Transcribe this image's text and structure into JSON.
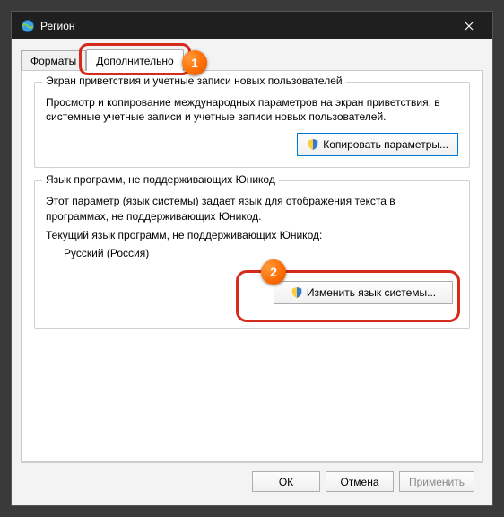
{
  "titlebar": {
    "title": "Регион"
  },
  "tabs": {
    "formats": "Форматы",
    "advanced": "Дополнительно"
  },
  "badges": {
    "one": "1",
    "two": "2"
  },
  "group1": {
    "title": "Экран приветствия и учетные записи новых пользователей",
    "desc": "Просмотр и копирование международных параметров на экран приветствия, в системные учетные записи и учетные записи новых пользователей.",
    "button": "Копировать параметры..."
  },
  "group2": {
    "title": "Язык программ, не поддерживающих Юникод",
    "desc": "Этот параметр (язык системы) задает язык для отображения текста в программах, не поддерживающих Юникод.",
    "current_label": "Текущий язык программ, не поддерживающих Юникод:",
    "current_value": "Русский (Россия)",
    "button": "Изменить язык системы..."
  },
  "footer": {
    "ok": "ОК",
    "cancel": "Отмена",
    "apply": "Применить"
  }
}
